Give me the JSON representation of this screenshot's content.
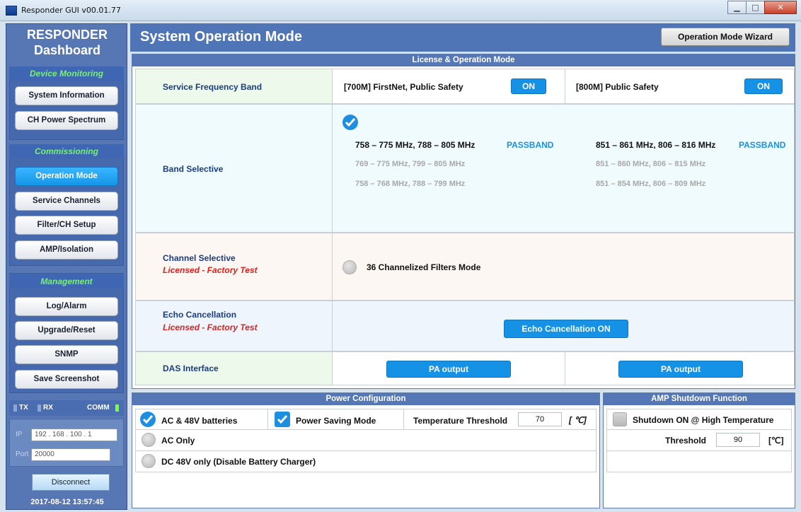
{
  "window": {
    "title": "Responder GUI v00.01.77",
    "controls": [
      "minimize",
      "maximize",
      "close"
    ]
  },
  "sidebar": {
    "title_line1": "RESPONDER",
    "title_line2": "Dashboard",
    "sections": [
      {
        "label": "Device Monitoring",
        "items": [
          "System Information",
          "CH Power Spectrum"
        ]
      },
      {
        "label": "Commissioning",
        "items": [
          "Operation Mode",
          "Service Channels",
          "Filter/CH Setup",
          "AMP/Isolation"
        ]
      },
      {
        "label": "Management",
        "items": [
          "Log/Alarm",
          "Upgrade/Reset",
          "SNMP",
          "Save Screenshot"
        ]
      }
    ],
    "active_item": "Operation Mode",
    "status": {
      "tx": "TX",
      "rx": "RX",
      "comm": "COMM",
      "comm_color": "#7dff3a"
    },
    "ip_label": "IP",
    "ip_value": "192 . 168 . 100 .  1",
    "port_label": "Port",
    "port_value": "20000",
    "disconnect_label": "Disconnect",
    "datetime": "2017-08-12 13:57:45"
  },
  "header": {
    "title": "System Operation Mode",
    "wizard_button": "Operation Mode Wizard"
  },
  "license_panel": {
    "heading": "License & Operation Mode",
    "service_frequency_band": {
      "label": "Service Frequency Band",
      "band_700": "[700M] FirstNet, Public Safety",
      "band_700_state": "ON",
      "band_800": "[800M] Public Safety",
      "band_800_state": "ON"
    },
    "band_selective": {
      "label": "Band Selective",
      "checked": true,
      "left_options": [
        "758 – 775 MHz, 788 – 805 MHz",
        "769 – 775 MHz, 799 – 805 MHz",
        "758 – 768 MHz, 788 – 799 MHz"
      ],
      "right_options": [
        "851 – 861 MHz, 806 – 816 MHz",
        "851 – 860 MHz, 806 – 815 MHz",
        "851 – 854 MHz, 806 – 809 MHz"
      ],
      "passband_label": "PASSBAND"
    },
    "channel_selective": {
      "label": "Channel Selective",
      "license_note": "Licensed - Factory Test",
      "option": "36 Channelized Filters Mode"
    },
    "echo_cancellation": {
      "label": "Echo Cancellation",
      "license_note": "Licensed - Factory Test",
      "button": "Echo Cancellation ON"
    },
    "das_interface": {
      "label": "DAS Interface",
      "left_button": "PA output",
      "right_button": "PA output"
    }
  },
  "power_panel": {
    "heading": "Power Configuration",
    "opt_ac_48v": "AC & 48V batteries",
    "opt_power_saving": "Power Saving Mode",
    "temp_threshold_label": "Temperature Threshold",
    "temp_threshold_value": "70",
    "temp_unit": "[ ℃]",
    "opt_ac_only": "AC Only",
    "opt_dc_48v": "DC 48V only (Disable Battery Charger)"
  },
  "amp_panel": {
    "heading": "AMP Shutdown Function",
    "shutdown_label": "Shutdown ON @ High Temperature",
    "threshold_label": "Threshold",
    "threshold_value": "90",
    "threshold_unit": "[℃]"
  },
  "colors": {
    "accent_blue": "#1592e6",
    "sidebar_bg": "#5677b4",
    "section_text_green": "#78f078",
    "license_red": "#e0201c",
    "label_navy": "#1a3c86"
  }
}
